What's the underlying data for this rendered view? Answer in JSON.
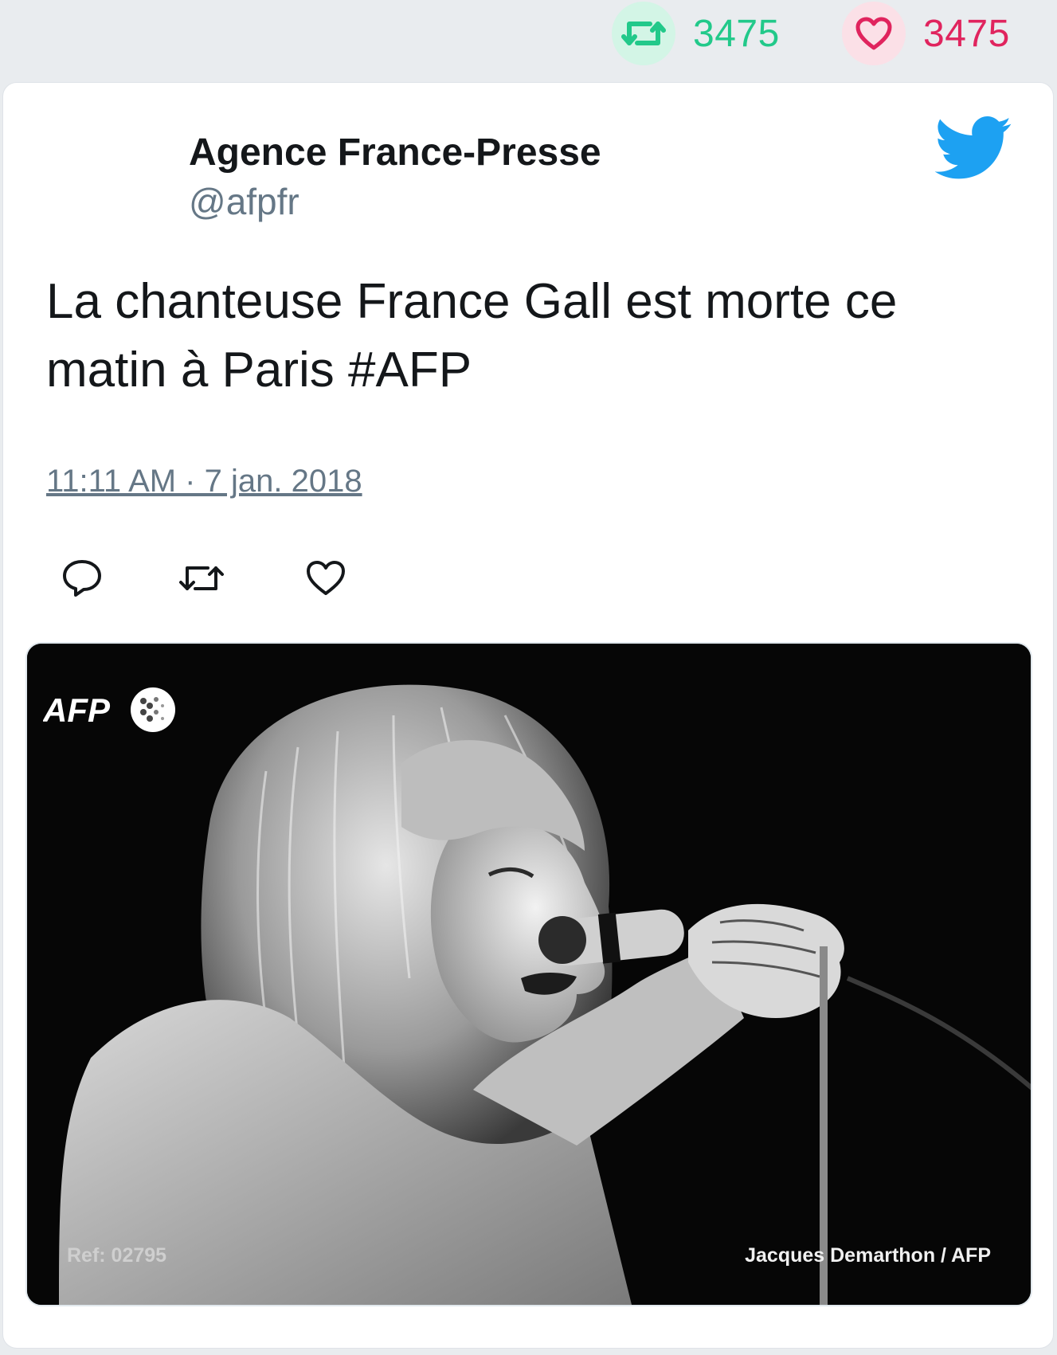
{
  "engagement": {
    "retweet_icon": "retweet-icon",
    "retweet_count": "3475",
    "like_icon": "heart-icon",
    "like_count": "3475"
  },
  "tweet": {
    "author_name": "Agence France-Presse",
    "author_handle": "@afpfr",
    "text": "La chanteuse France Gall est morte ce matin à Paris #AFP",
    "timestamp": "11:11 AM · 7 jan. 2018",
    "brand_icon": "twitter-bird-icon",
    "actions": {
      "reply_icon": "reply-icon",
      "retweet_icon": "retweet-icon",
      "like_icon": "heart-icon"
    }
  },
  "media": {
    "description_icon": "photo",
    "logo_text": "AFP",
    "ref_text": "Ref: 02795",
    "credit_text": "Jacques Demarthon / AFP"
  },
  "colors": {
    "page_background": "#e9ecef",
    "retweet_green": "#22c98a",
    "like_red": "#e0245e",
    "twitter_blue": "#1da1f2",
    "handle_gray": "#657786",
    "text_dark": "#14171a"
  }
}
